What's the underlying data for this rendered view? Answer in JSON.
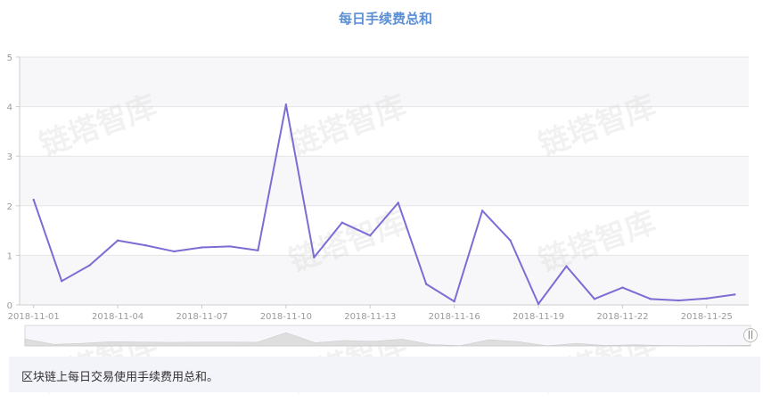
{
  "chart_data": {
    "type": "line",
    "title": "每日手续费总和",
    "xlabel": "",
    "ylabel": "",
    "ylim": [
      0,
      5
    ],
    "yticks": [
      "0",
      "1",
      "2",
      "3",
      "4",
      "5"
    ],
    "xticks": [
      "2018-11-01",
      "2018-11-04",
      "2018-11-07",
      "2018-11-10",
      "2018-11-13",
      "2018-11-16",
      "2018-11-19",
      "2018-11-22",
      "2018-11-25"
    ],
    "x": [
      "2018-11-01",
      "2018-11-02",
      "2018-11-03",
      "2018-11-04",
      "2018-11-05",
      "2018-11-06",
      "2018-11-07",
      "2018-11-08",
      "2018-11-09",
      "2018-11-10",
      "2018-11-11",
      "2018-11-12",
      "2018-11-13",
      "2018-11-14",
      "2018-11-15",
      "2018-11-16",
      "2018-11-17",
      "2018-11-18",
      "2018-11-19",
      "2018-11-20",
      "2018-11-21",
      "2018-11-22",
      "2018-11-23",
      "2018-11-24",
      "2018-11-25",
      "2018-11-26"
    ],
    "series": [
      {
        "values": [
          2.12,
          0.48,
          0.8,
          1.3,
          1.2,
          1.08,
          1.16,
          1.18,
          1.1,
          4.04,
          0.96,
          1.66,
          1.4,
          2.06,
          0.42,
          0.07,
          1.9,
          1.3,
          0.02,
          0.78,
          0.12,
          0.35,
          0.12,
          0.09,
          0.13,
          0.21
        ],
        "color": "#7e6bd4"
      }
    ],
    "grid": true,
    "bands": [
      "#f7f7f9",
      "#ffffff"
    ]
  },
  "caption": "区块链上每日交易使用手续费用总和。",
  "watermark": "链塔智库",
  "zoom_handle_label": "||"
}
